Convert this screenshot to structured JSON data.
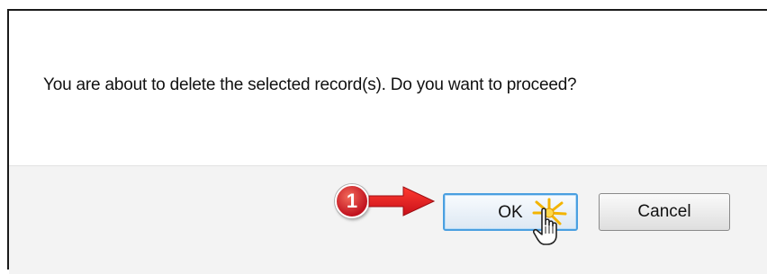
{
  "dialog": {
    "message": "You are about to delete the selected record(s). Do you want to proceed?"
  },
  "buttons": {
    "ok_label": "OK",
    "cancel_label": "Cancel"
  },
  "annotation": {
    "step_number": "1",
    "accent_color": "#d7141c"
  },
  "icons": {
    "arrow": "right-arrow-icon",
    "cursor": "hand-pointer-icon",
    "click": "click-burst-icon"
  }
}
